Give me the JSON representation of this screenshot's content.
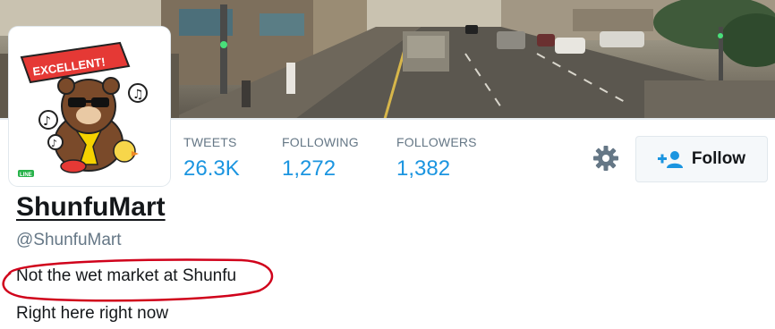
{
  "header": {
    "banner_image": "street-scene-photo"
  },
  "avatar": {
    "badge_text": "EXCELLENT!",
    "brand_text": "LINE",
    "image": "bear-cartoon-avatar"
  },
  "stats": [
    {
      "label": "TWEETS",
      "value": "26.3K"
    },
    {
      "label": "FOLLOWING",
      "value": "1,272"
    },
    {
      "label": "FOLLOWERS",
      "value": "1,382"
    }
  ],
  "actions": {
    "settings_icon": "gear-icon",
    "follow_label": "Follow",
    "follow_icon": "add-user-icon"
  },
  "profile": {
    "name": "ShunfuMart",
    "handle": "@ShunfuMart",
    "bio": "Not the wet market at Shunfu",
    "location": "Right here right now"
  },
  "colors": {
    "accent": "#1b95e0",
    "annotation": "#d0021b",
    "muted": "#657786"
  }
}
